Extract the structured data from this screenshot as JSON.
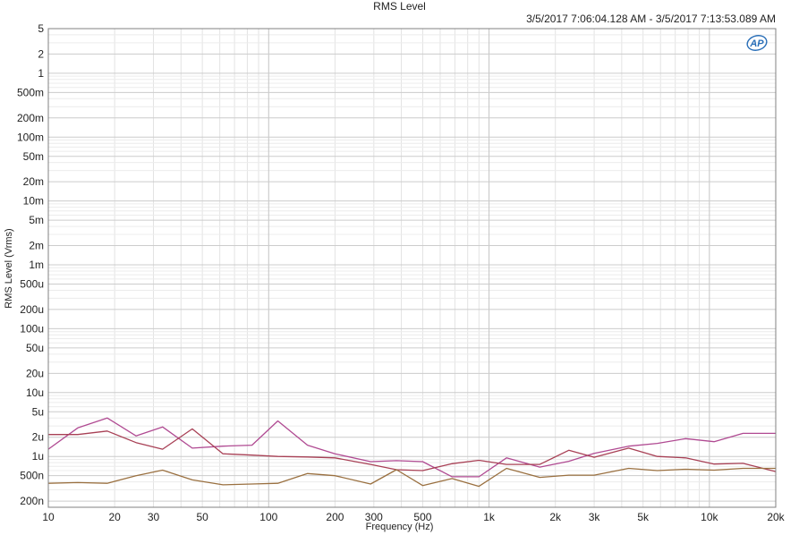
{
  "chart_data": {
    "type": "line",
    "title": "RMS Level",
    "subtitle": "3/5/2017 7:06:04.128 AM - 3/5/2017 7:13:53.089 AM",
    "xlabel": "Frequency (Hz)",
    "ylabel": "RMS Level (Vrms)",
    "x_scale": "log",
    "y_scale": "log",
    "xlim": [
      10,
      20000
    ],
    "ylim": [
      1.6e-07,
      5
    ],
    "grid": true,
    "legend": "none",
    "x_ticks": [
      {
        "value": 10,
        "label": "10"
      },
      {
        "value": 20,
        "label": "20"
      },
      {
        "value": 30,
        "label": "30"
      },
      {
        "value": 50,
        "label": "50"
      },
      {
        "value": 100,
        "label": "100"
      },
      {
        "value": 200,
        "label": "200"
      },
      {
        "value": 300,
        "label": "300"
      },
      {
        "value": 500,
        "label": "500"
      },
      {
        "value": 1000,
        "label": "1k"
      },
      {
        "value": 2000,
        "label": "2k"
      },
      {
        "value": 3000,
        "label": "3k"
      },
      {
        "value": 5000,
        "label": "5k"
      },
      {
        "value": 10000,
        "label": "10k"
      },
      {
        "value": 20000,
        "label": "20k"
      }
    ],
    "y_ticks": [
      {
        "value": 5,
        "label": "5"
      },
      {
        "value": 2,
        "label": "2"
      },
      {
        "value": 1,
        "label": "1"
      },
      {
        "value": 0.5,
        "label": "500m"
      },
      {
        "value": 0.2,
        "label": "200m"
      },
      {
        "value": 0.1,
        "label": "100m"
      },
      {
        "value": 0.05,
        "label": "50m"
      },
      {
        "value": 0.02,
        "label": "20m"
      },
      {
        "value": 0.01,
        "label": "10m"
      },
      {
        "value": 0.005,
        "label": "5m"
      },
      {
        "value": 0.002,
        "label": "2m"
      },
      {
        "value": 0.001,
        "label": "1m"
      },
      {
        "value": 0.0005,
        "label": "500u"
      },
      {
        "value": 0.0002,
        "label": "200u"
      },
      {
        "value": 0.0001,
        "label": "100u"
      },
      {
        "value": 5e-05,
        "label": "50u"
      },
      {
        "value": 2e-05,
        "label": "20u"
      },
      {
        "value": 1e-05,
        "label": "10u"
      },
      {
        "value": 5e-06,
        "label": "5u"
      },
      {
        "value": 2e-06,
        "label": "2u"
      },
      {
        "value": 1e-06,
        "label": "1u"
      },
      {
        "value": 5e-07,
        "label": "500n"
      },
      {
        "value": 2e-07,
        "label": "200n"
      }
    ],
    "series": [
      {
        "color": "#b04a92",
        "x": [
          10,
          13.6,
          18.5,
          25,
          33,
          45,
          62,
          84,
          110,
          150,
          200,
          290,
          380,
          500,
          680,
          900,
          1200,
          1700,
          2300,
          3000,
          4300,
          5800,
          7800,
          10500,
          14200,
          20000
        ],
        "y": [
          1.3e-06,
          2.8e-06,
          4e-06,
          2.1e-06,
          2.9e-06,
          1.35e-06,
          1.45e-06,
          1.5e-06,
          3.6e-06,
          1.5e-06,
          1.1e-06,
          8.3e-07,
          8.6e-07,
          8.3e-07,
          4.8e-07,
          4.8e-07,
          9.5e-07,
          6.8e-07,
          8.4e-07,
          1.12e-06,
          1.45e-06,
          1.6e-06,
          1.9e-06,
          1.7e-06,
          2.3e-06,
          2.3e-06
        ]
      },
      {
        "color": "#a84055",
        "x": [
          10,
          13.6,
          18.5,
          25,
          33,
          45,
          62,
          84,
          110,
          150,
          200,
          290,
          380,
          500,
          680,
          900,
          1200,
          1700,
          2300,
          3000,
          4300,
          5800,
          7800,
          10500,
          14200,
          20000
        ],
        "y": [
          2.2e-06,
          2.2e-06,
          2.5e-06,
          1.65e-06,
          1.3e-06,
          2.7e-06,
          1.1e-06,
          1.05e-06,
          1e-06,
          9.8e-07,
          9.5e-07,
          7.5e-07,
          6.2e-07,
          6e-07,
          7.7e-07,
          8.7e-07,
          7.5e-07,
          7.5e-07,
          1.25e-06,
          9.7e-07,
          1.35e-06,
          1e-06,
          9.5e-07,
          7.6e-07,
          7.8e-07,
          5.8e-07
        ]
      },
      {
        "color": "#9a7040",
        "x": [
          10,
          13.6,
          18.5,
          25,
          33,
          45,
          62,
          84,
          110,
          150,
          200,
          290,
          380,
          500,
          680,
          900,
          1200,
          1700,
          2300,
          3000,
          4300,
          5800,
          7800,
          10500,
          14200,
          20000
        ],
        "y": [
          3.8e-07,
          3.9e-07,
          3.8e-07,
          5e-07,
          6.1e-07,
          4.3e-07,
          3.6e-07,
          3.7e-07,
          3.8e-07,
          5.4e-07,
          5e-07,
          3.7e-07,
          6.2e-07,
          3.5e-07,
          4.5e-07,
          3.4e-07,
          6.5e-07,
          4.7e-07,
          5.1e-07,
          5.1e-07,
          6.5e-07,
          6e-07,
          6.3e-07,
          6.1e-07,
          6.5e-07,
          6.5e-07
        ]
      }
    ],
    "logo_text": "AP"
  }
}
